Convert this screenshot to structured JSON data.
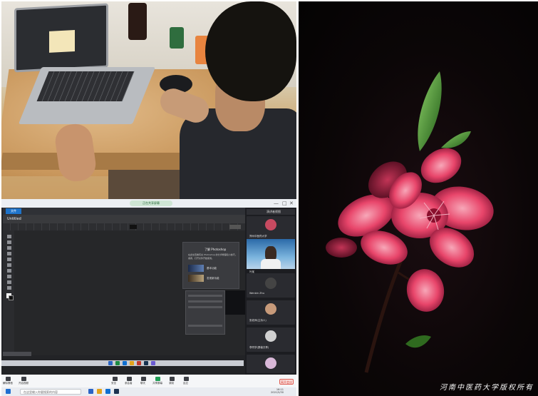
{
  "meeting": {
    "share_pill": "正在共享屏幕",
    "window_controls": [
      "—",
      "□",
      "✕"
    ]
  },
  "photoshop": {
    "logo": "文件",
    "doc_tab": "Untitled",
    "learn_panel": {
      "title": "了解 Photoshop",
      "text": "在此处查看有关 Photoshop 的分步教程和小技巧，或者，打开文件开始使用。",
      "items": [
        "基本功能",
        "发现新功能"
      ]
    }
  },
  "gallery": {
    "header": "演讲者视图",
    "participants": [
      "郑州中医药大学",
      "叶某",
      "Wenbin Zhu",
      "张老师(主持人)",
      "李同学(屏幕共享)"
    ]
  },
  "meeting_controls": {
    "labels": [
      "解除静音",
      "开启视频",
      "安全",
      "参会者",
      "聊天",
      "共享屏幕",
      "录制",
      "反应",
      "应用"
    ],
    "end_button": "离开会议"
  },
  "taskbar": {
    "search_placeholder": "在这里输入你要搜索的内容",
    "clock_time": "16:11",
    "clock_date": "2021/5/30"
  },
  "flower_photo": {
    "caption": "河南中医药大学版权所有"
  },
  "colors": {
    "ps_dark": "#222326",
    "meeting_end_red": "#d83b2f",
    "petal_pink": "#e8456a",
    "leaf_green": "#3b8a2c"
  }
}
